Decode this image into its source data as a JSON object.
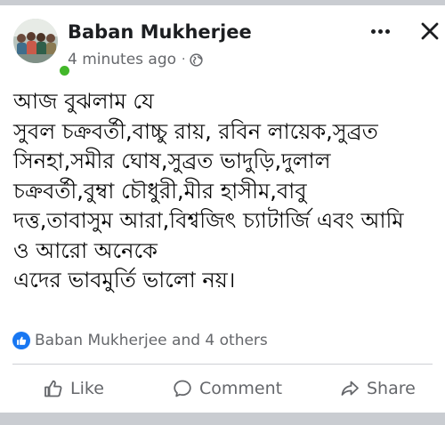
{
  "post": {
    "author": "Baban Mukherjee",
    "time": "4 minutes ago",
    "privacy_icon": "globe-icon",
    "body_lines": [
      "আজ বুঝলাম যে",
      "সুবল চক্রবর্তী,বাচ্চু রায়, রবিন লায়েক,সুব্রত",
      "সিনহা,সমীর ঘোষ,সুব্রত ভাদুড়ি,দুলাল",
      "চক্রবর্তী,বুম্বা চৌধুরী,মীর হাসীম,বাবু",
      "দত্ত,তাবাসুম আরা,বিশ্বজিৎ চ্যাটার্জি এবং আমি",
      "ও আরো অনেকে",
      "এদের ভাবমুর্তি ভালো নয়।"
    ]
  },
  "reactions": {
    "text": "Baban Mukherjee and 4 others",
    "icon": "like-reaction-icon",
    "color": "#1877f2"
  },
  "actions": {
    "like": "Like",
    "comment": "Comment",
    "share": "Share"
  },
  "colors": {
    "text_primary": "#1c1e21",
    "text_secondary": "#65676b",
    "online": "#42b72a",
    "divider": "#ced0d4",
    "separator_bar": "#c9ccd1"
  }
}
